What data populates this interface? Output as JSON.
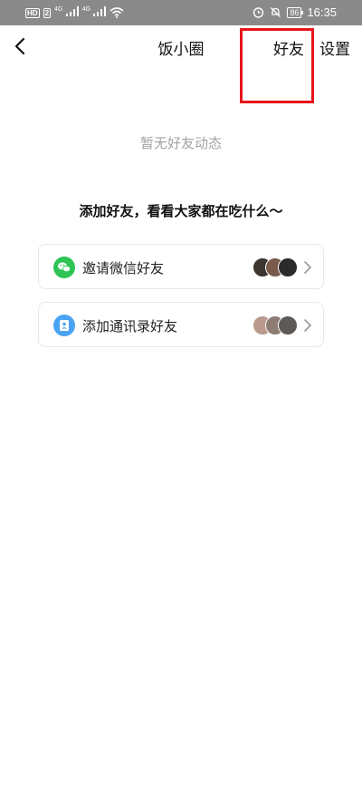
{
  "status_bar": {
    "hd_badge": "HD",
    "sim_badge": "2",
    "net1": "4G",
    "net2": "4G",
    "battery": "86",
    "time": "16:35"
  },
  "nav": {
    "title": "饭小圈",
    "friends_label": "好友",
    "settings_label": "设置"
  },
  "empty_state": {
    "text": "暂无好友动态"
  },
  "add_friends": {
    "title": "添加好友，看看大家都在吃什么～",
    "options": [
      {
        "label": "邀请微信好友",
        "icon": "wechat-icon",
        "icon_color": "#2ec456"
      },
      {
        "label": "添加通讯录好友",
        "icon": "contacts-icon",
        "icon_color": "#4aa3f2"
      }
    ]
  },
  "colors": {
    "highlight": "#e8141b",
    "status_bar_bg": "#8a8a8a",
    "muted_text": "#a3a3a3"
  }
}
